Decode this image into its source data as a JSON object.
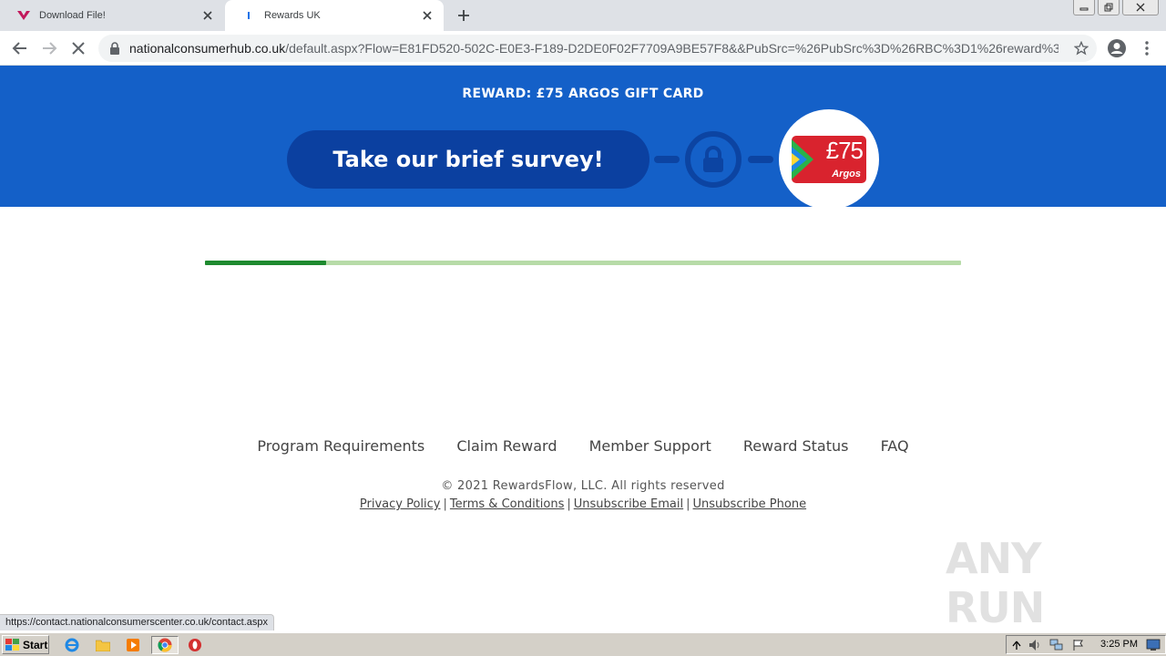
{
  "browser": {
    "tabs": [
      {
        "title": "Download File!",
        "favicon": "download-file-favicon",
        "active": false
      },
      {
        "title": "Rewards UK",
        "favicon": "loading-favicon",
        "active": true
      }
    ],
    "url_host": "nationalconsumerhub.co.uk",
    "url_path": "/default.aspx?Flow=E81FD520-502C-E0E3-F189-D2DE0F02F7709A9BE57F8&&PubSrc=%26PubSrc%3D%26RBC%3D1%26reward%3..."
  },
  "hero": {
    "reward_line": "REWARD: £75 ARGOS GIFT CARD",
    "survey_button": "Take our brief survey!",
    "gift_card": {
      "amount": "£75",
      "brand": "Argos"
    },
    "colors": {
      "banner": "#1460c8",
      "button": "#0b40a0",
      "card": "#d9232e"
    }
  },
  "progress": {
    "percent": 16,
    "colors": {
      "fill": "#1e8a2f",
      "track": "#b7dba8"
    }
  },
  "footer": {
    "nav": [
      "Program Requirements",
      "Claim Reward",
      "Member Support",
      "Reward Status",
      "FAQ"
    ],
    "copyright": "© 2021 RewardsFlow, LLC. All rights reserved",
    "legal": [
      "Privacy Policy",
      "Terms & Conditions",
      "Unsubscribe Email",
      "Unsubscribe Phone"
    ],
    "separator": "|"
  },
  "status_url": "https://contact.nationalconsumerscenter.co.uk/contact.aspx",
  "watermark": "ANY RUN",
  "taskbar": {
    "start_label": "Start",
    "clock": "3:25 PM"
  }
}
